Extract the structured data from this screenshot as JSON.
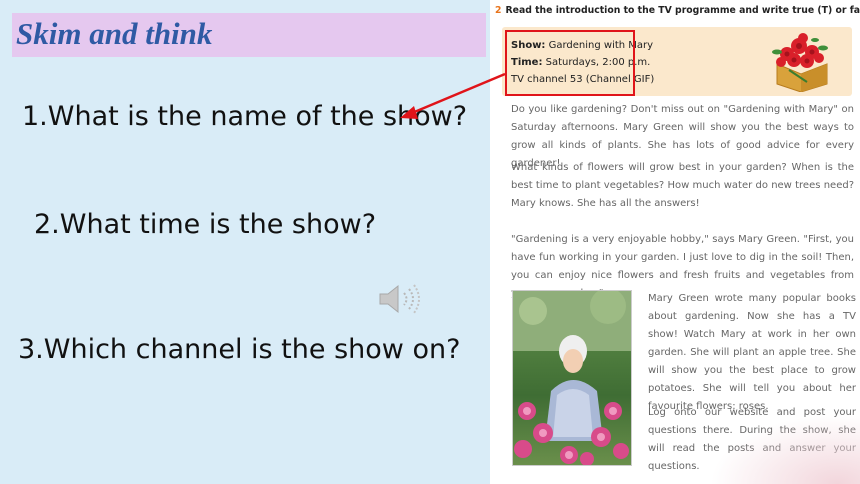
{
  "slide": {
    "title": "Skim and think",
    "questions": [
      "1.What is the name of the show?",
      "2.What time is the show?",
      "3.Which channel is the show on?"
    ]
  },
  "textbook": {
    "instruction_number": "2",
    "instruction": "Read the introduction to the TV programme and write true (T) or false (F).",
    "info": {
      "show_label": "Show:",
      "show_value": " Gardening with Mary",
      "time_label": "Time:",
      "time_value": " Saturdays, 2:00 p.m.",
      "channel": "TV channel 53 (Channel GIF)"
    },
    "paragraphs": [
      "Do you like gardening? Don't miss out on \"Gardening with Mary\" on Saturday afternoons. Mary Green will show you the best ways to grow all kinds of plants. She has lots of good advice for every gardener!",
      "What kinds of flowers will grow best in your garden? When is the best time to plant vegetables? How much water do new trees need? Mary knows. She has all the answers!",
      "\"Gardening is a very enjoyable hobby,\" says Mary Green. \"First, you have fun working in your garden. I just love to dig in the soil! Then, you can enjoy nice flowers and fresh fruits and vegetables from your own garden.\"",
      "Mary Green wrote many popular books about gardening. Now she has a TV show! Watch Mary at work in her own garden. She will plant an apple tree. She will show you the best place to grow potatoes. She will tell you about her favourite flowers: roses.",
      "Log onto our website and post your questions there. During the show, she will read the posts and answer your questions."
    ]
  },
  "colors": {
    "background": "#d9ecf7",
    "title_band": "#e5c8ef",
    "title_text": "#2f5aa4",
    "highlight": "#e0141a",
    "info_box": "#fbe8cc"
  },
  "icons": [
    "speaker-icon",
    "flower-basket-image",
    "gardener-photo",
    "red-arrow"
  ]
}
